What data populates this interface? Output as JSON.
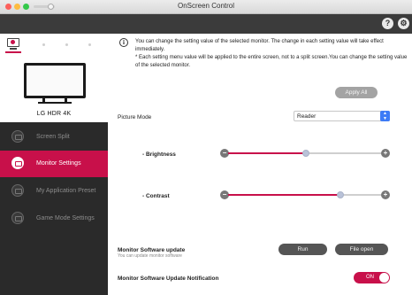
{
  "window": {
    "title": "OnScreen Control"
  },
  "header": {
    "help_icon": "?",
    "settings_icon": "gear-icon"
  },
  "monitor": {
    "name": "LG HDR 4K"
  },
  "sidebar": {
    "items": [
      {
        "label": "Screen Split",
        "active": false
      },
      {
        "label": "Monitor Settings",
        "active": true
      },
      {
        "label": "My Application Preset",
        "active": false
      },
      {
        "label": "Game Mode Settings",
        "active": false
      }
    ]
  },
  "main": {
    "info_line1": "You can change the setting value of the selected monitor. The change in each setting value will take effect immediately.",
    "info_line2": "* Each setting menu value will be applied to the entire screen, not to a split screen.You can change the setting value of the selected monitor.",
    "apply_all_label": "Apply All",
    "picture_mode_label": "Picture Mode",
    "picture_mode_value": "Reader",
    "brightness_label": "- Brightness",
    "brightness_level": 0.5,
    "contrast_label": "- Contrast",
    "contrast_level": 0.72,
    "minus": "−",
    "plus": "+",
    "software_update_title": "Monitor Software update",
    "software_update_sub": "You can update monitor software",
    "run_label": "Run",
    "file_open_label": "File open",
    "notification_label": "Monitor Software Update Notification",
    "notification_toggle": "ON"
  },
  "colors": {
    "accent": "#c8104a",
    "sidebar_bg": "#2a2a2a",
    "header_bg": "#3b3b3b"
  }
}
